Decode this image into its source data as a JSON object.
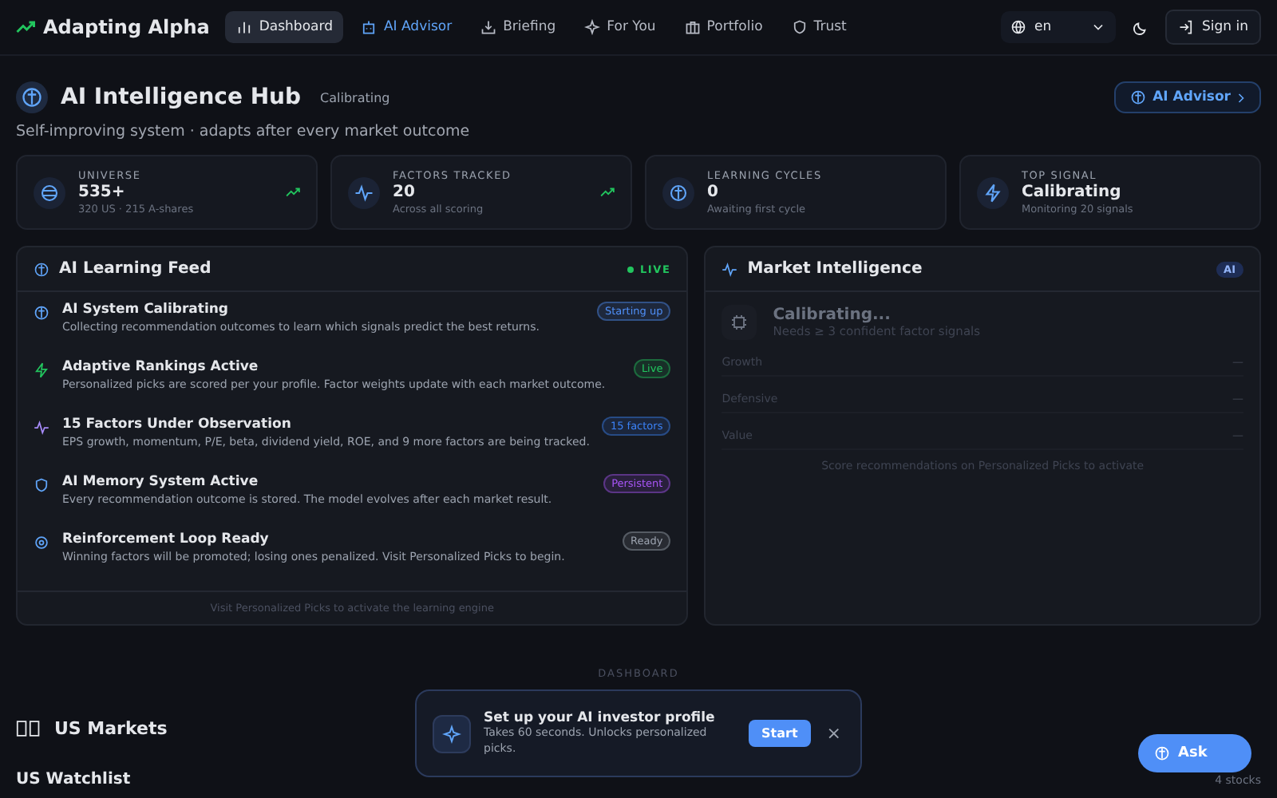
{
  "nav": {
    "brand": "Adapting Alpha",
    "items": [
      {
        "label": "Dashboard",
        "kind": "plain",
        "selected": true
      },
      {
        "label": "AI Advisor",
        "kind": "accent",
        "selected": false
      },
      {
        "label": "Briefing",
        "kind": "plain",
        "selected": false
      },
      {
        "label": "For You",
        "kind": "plain",
        "selected": false
      },
      {
        "label": "Portfolio",
        "kind": "plain",
        "selected": false
      },
      {
        "label": "Trust",
        "kind": "plain",
        "selected": false
      }
    ],
    "language": "en",
    "sign_in": "Sign in"
  },
  "hub": {
    "title": "AI Intelligence Hub",
    "status": "Calibrating",
    "subtitle": "Self-improving system · adapts after every market outcome",
    "advisor_button": "AI Advisor"
  },
  "stats": [
    {
      "label": "UNIVERSE",
      "value": "535+",
      "sub": "320 US · 215 A-shares",
      "trend": true
    },
    {
      "label": "FACTORS TRACKED",
      "value": "20",
      "sub": "Across all scoring",
      "trend": true
    },
    {
      "label": "LEARNING CYCLES",
      "value": "0",
      "sub": "Awaiting first cycle",
      "trend": false
    },
    {
      "label": "TOP SIGNAL",
      "value": "Calibrating",
      "sub": "Monitoring 20 signals",
      "trend": false
    }
  ],
  "feed": {
    "title": "AI Learning Feed",
    "live": "LIVE",
    "items": [
      {
        "title": "AI System Calibrating",
        "text": "Collecting recommendation outcomes to learn which signals predict the best returns.",
        "badge": "Starting up",
        "color": "#4f8ff7"
      },
      {
        "title": "Adaptive Rankings Active",
        "text": "Personalized picks are scored per your profile. Factor weights update with each market outcome.",
        "badge": "Live",
        "color": "#22c55e"
      },
      {
        "title": "15 Factors Under Observation",
        "text": "EPS growth, momentum, P/E, beta, dividend yield, ROE, and 9 more factors are being tracked.",
        "badge": "15 factors",
        "color": "#3b82f6"
      },
      {
        "title": "AI Memory System Active",
        "text": "Every recommendation outcome is stored. The model evolves after each market result.",
        "badge": "Persistent",
        "color": "#a855f7"
      },
      {
        "title": "Reinforcement Loop Ready",
        "text": "Winning factors will be promoted; losing ones penalized. Visit Personalized Picks to begin.",
        "badge": "Ready",
        "color": "#9ca3af"
      }
    ],
    "footer": "Visit Personalized Picks to activate the learning engine"
  },
  "market": {
    "title": "Market Intelligence",
    "badge": "AI",
    "status": "Calibrating...",
    "note": "Needs ≥ 3 confident factor signals",
    "rows": [
      {
        "label": "Growth",
        "value": "—"
      },
      {
        "label": "Defensive",
        "value": "—"
      },
      {
        "label": "Value",
        "value": "—"
      }
    ],
    "footer": "Score recommendations on Personalized Picks to activate"
  },
  "section_label": "DASHBOARD",
  "markets": {
    "title": "US Markets",
    "watchlist": "US Watchlist",
    "count": "4 stocks"
  },
  "toast": {
    "title": "Set up your AI investor profile",
    "text": "Takes 60 seconds. Unlocks personalized picks.",
    "button": "Start",
    "close": "×"
  },
  "ask_button": "Ask"
}
